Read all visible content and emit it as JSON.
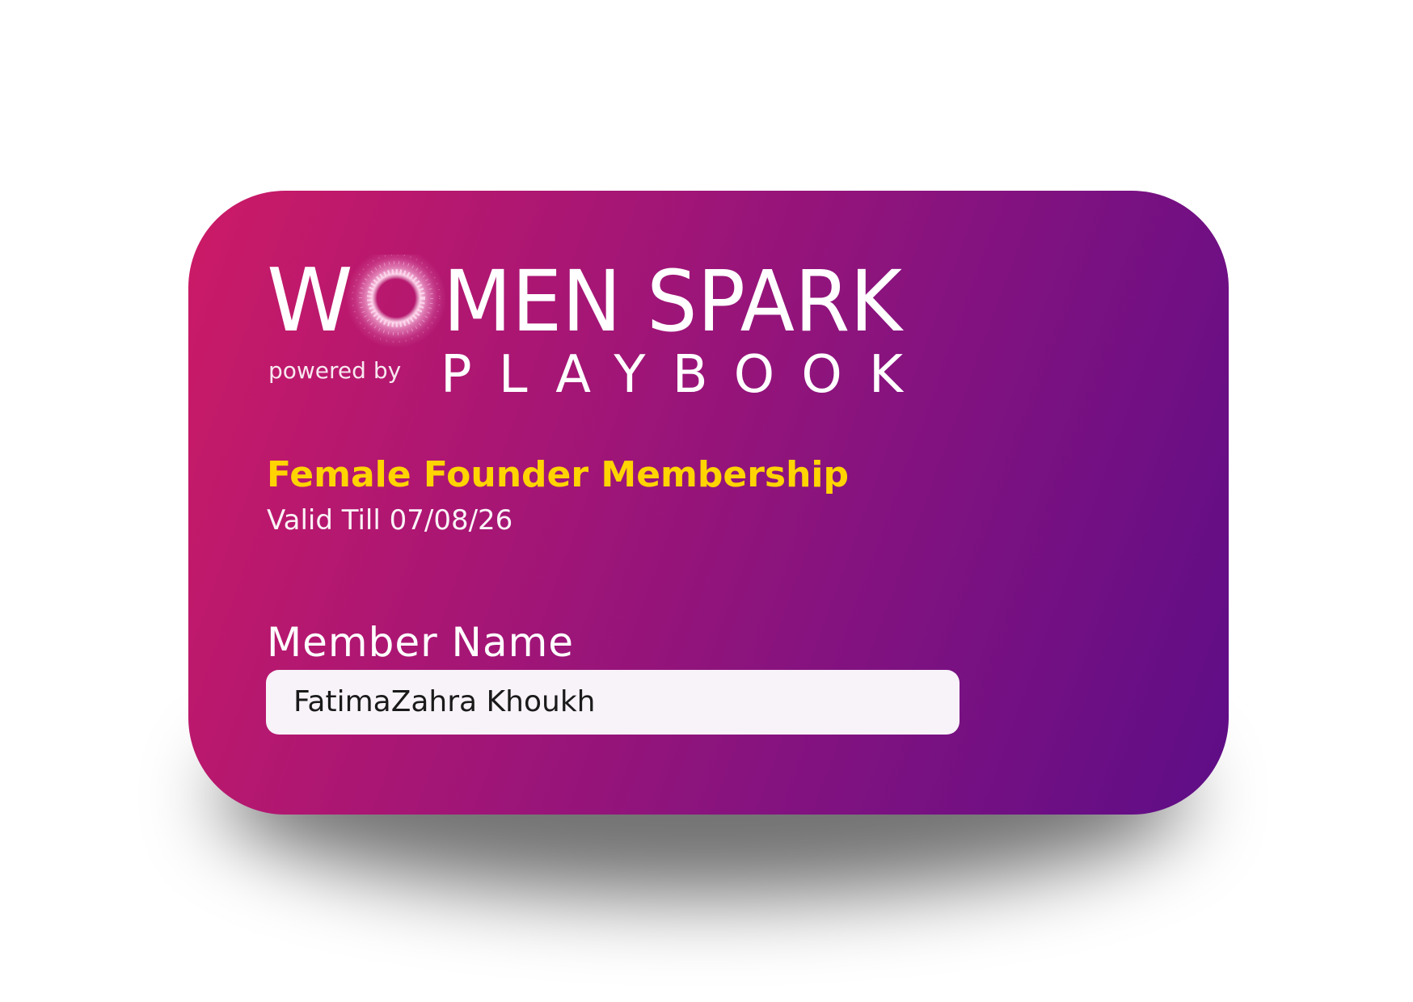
{
  "brand": {
    "logo_text_left": "W",
    "logo_text_right": "MEN SPARK",
    "powered_by": "powered by",
    "sub_brand": "PLAYBOOK"
  },
  "membership": {
    "title": "Female Founder Membership",
    "valid_till": "Valid Till 07/08/26"
  },
  "member": {
    "label": "Member Name",
    "name": "FatimaZahra Khoukh"
  },
  "colors": {
    "gradient_start": "#cc1b66",
    "gradient_end": "#5e0d87",
    "accent_yellow": "#ffd400",
    "field_background": "#f8f2f9"
  }
}
